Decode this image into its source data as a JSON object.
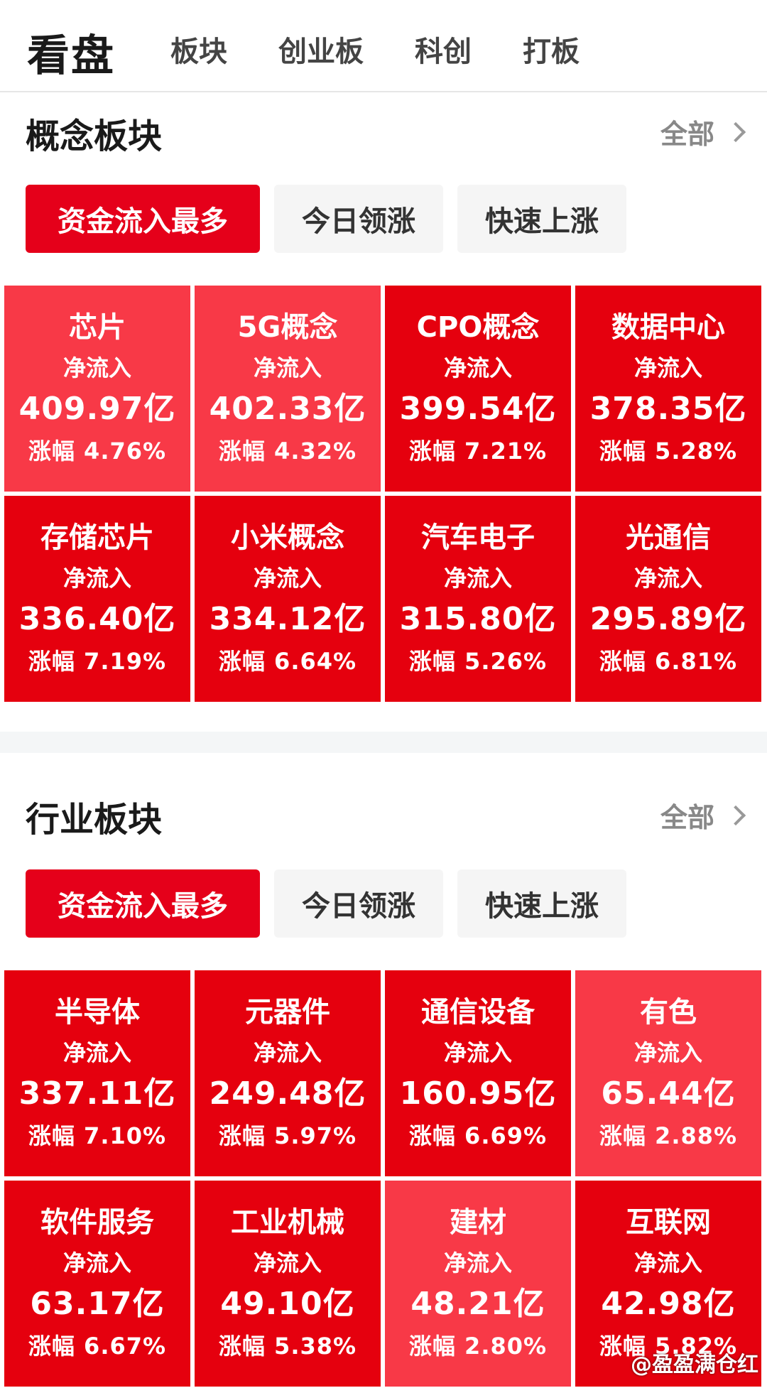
{
  "header": {
    "title": "看盘",
    "nav": [
      "板块",
      "创业板",
      "科创",
      "打板"
    ]
  },
  "concept": {
    "title": "概念板块",
    "all_label": "全部",
    "tabs": [
      "资金流入最多",
      "今日领涨",
      "快速上涨"
    ],
    "cells": [
      {
        "name": "芯片",
        "label": "净流入",
        "value": "409.97亿",
        "change": "涨幅 4.76%",
        "shade": "light"
      },
      {
        "name": "5G概念",
        "label": "净流入",
        "value": "402.33亿",
        "change": "涨幅 4.32%",
        "shade": "light"
      },
      {
        "name": "CPO概念",
        "label": "净流入",
        "value": "399.54亿",
        "change": "涨幅 7.21%",
        "shade": "strong"
      },
      {
        "name": "数据中心",
        "label": "净流入",
        "value": "378.35亿",
        "change": "涨幅 5.28%",
        "shade": "strong"
      },
      {
        "name": "存储芯片",
        "label": "净流入",
        "value": "336.40亿",
        "change": "涨幅 7.19%",
        "shade": "strong"
      },
      {
        "name": "小米概念",
        "label": "净流入",
        "value": "334.12亿",
        "change": "涨幅 6.64%",
        "shade": "strong"
      },
      {
        "name": "汽车电子",
        "label": "净流入",
        "value": "315.80亿",
        "change": "涨幅 5.26%",
        "shade": "strong"
      },
      {
        "name": "光通信",
        "label": "净流入",
        "value": "295.89亿",
        "change": "涨幅 6.81%",
        "shade": "strong"
      }
    ]
  },
  "industry": {
    "title": "行业板块",
    "all_label": "全部",
    "tabs": [
      "资金流入最多",
      "今日领涨",
      "快速上涨"
    ],
    "cells": [
      {
        "name": "半导体",
        "label": "净流入",
        "value": "337.11亿",
        "change": "涨幅 7.10%",
        "shade": "strong"
      },
      {
        "name": "元器件",
        "label": "净流入",
        "value": "249.48亿",
        "change": "涨幅 5.97%",
        "shade": "strong"
      },
      {
        "name": "通信设备",
        "label": "净流入",
        "value": "160.95亿",
        "change": "涨幅 6.69%",
        "shade": "strong"
      },
      {
        "name": "有色",
        "label": "净流入",
        "value": "65.44亿",
        "change": "涨幅 2.88%",
        "shade": "light"
      },
      {
        "name": "软件服务",
        "label": "净流入",
        "value": "63.17亿",
        "change": "涨幅 6.67%",
        "shade": "strong"
      },
      {
        "name": "工业机械",
        "label": "净流入",
        "value": "49.10亿",
        "change": "涨幅 5.38%",
        "shade": "strong"
      },
      {
        "name": "建材",
        "label": "净流入",
        "value": "48.21亿",
        "change": "涨幅 2.80%",
        "shade": "light"
      },
      {
        "name": "互联网",
        "label": "净流入",
        "value": "42.98亿",
        "change": "涨幅 5.82%",
        "shade": "strong"
      }
    ]
  },
  "watermark": "@盈盈满仓红",
  "colors": {
    "accent": "#e5001a",
    "cell_strong": "#e5000e",
    "cell_light": "#f83947"
  }
}
